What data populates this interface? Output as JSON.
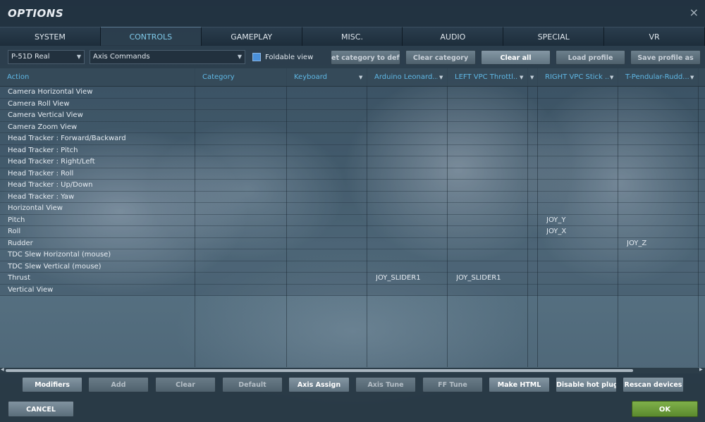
{
  "window": {
    "title": "OPTIONS",
    "close_glyph": "×"
  },
  "tabs": [
    {
      "label": "SYSTEM",
      "active": false
    },
    {
      "label": "CONTROLS",
      "active": true
    },
    {
      "label": "GAMEPLAY",
      "active": false
    },
    {
      "label": "MISC.",
      "active": false
    },
    {
      "label": "AUDIO",
      "active": false
    },
    {
      "label": "SPECIAL",
      "active": false
    },
    {
      "label": "VR",
      "active": false
    }
  ],
  "toolbar": {
    "aircraft_select": "P-51D Real",
    "category_select": "Axis Commands",
    "foldable_view_label": "Foldable view",
    "foldable_view_checked": true,
    "reset_category_label": "et category to defa",
    "clear_category_label": "Clear category",
    "clear_all_label": "Clear all",
    "load_profile_label": "Load profile",
    "save_profile_label": "Save profile as"
  },
  "grid": {
    "headers": {
      "action": "Action",
      "category": "Category",
      "keyboard": "Keyboard",
      "device1": "Arduino Leonard...",
      "device2": "LEFT VPC Throttl...",
      "device3": "RIGHT VPC Stick ...",
      "device4": "T-Pendular-Rudd..."
    },
    "rows": [
      {
        "action": "Camera Horizontal View",
        "d1": "",
        "d2": "",
        "d3": "",
        "d4": ""
      },
      {
        "action": "Camera Roll View",
        "d1": "",
        "d2": "",
        "d3": "",
        "d4": ""
      },
      {
        "action": "Camera Vertical View",
        "d1": "",
        "d2": "",
        "d3": "",
        "d4": ""
      },
      {
        "action": "Camera Zoom View",
        "d1": "",
        "d2": "",
        "d3": "",
        "d4": ""
      },
      {
        "action": "Head Tracker : Forward/Backward",
        "d1": "",
        "d2": "",
        "d3": "",
        "d4": ""
      },
      {
        "action": "Head Tracker : Pitch",
        "d1": "",
        "d2": "",
        "d3": "",
        "d4": ""
      },
      {
        "action": "Head Tracker : Right/Left",
        "d1": "",
        "d2": "",
        "d3": "",
        "d4": ""
      },
      {
        "action": "Head Tracker : Roll",
        "d1": "",
        "d2": "",
        "d3": "",
        "d4": ""
      },
      {
        "action": "Head Tracker : Up/Down",
        "d1": "",
        "d2": "",
        "d3": "",
        "d4": ""
      },
      {
        "action": "Head Tracker : Yaw",
        "d1": "",
        "d2": "",
        "d3": "",
        "d4": ""
      },
      {
        "action": "Horizontal View",
        "d1": "",
        "d2": "",
        "d3": "",
        "d4": ""
      },
      {
        "action": "Pitch",
        "d1": "",
        "d2": "",
        "d3": "JOY_Y",
        "d4": ""
      },
      {
        "action": "Roll",
        "d1": "",
        "d2": "",
        "d3": "JOY_X",
        "d4": ""
      },
      {
        "action": "Rudder",
        "d1": "",
        "d2": "",
        "d3": "",
        "d4": "JOY_Z"
      },
      {
        "action": "TDC Slew Horizontal (mouse)",
        "d1": "",
        "d2": "",
        "d3": "",
        "d4": ""
      },
      {
        "action": "TDC Slew Vertical (mouse)",
        "d1": "",
        "d2": "",
        "d3": "",
        "d4": ""
      },
      {
        "action": "Thrust",
        "d1": "JOY_SLIDER1",
        "d2": "JOY_SLIDER1",
        "d3": "",
        "d4": ""
      },
      {
        "action": "Vertical View",
        "d1": "",
        "d2": "",
        "d3": "",
        "d4": ""
      }
    ]
  },
  "bottom_buttons": {
    "modifiers": "Modifiers",
    "add": "Add",
    "clear": "Clear",
    "default": "Default",
    "axis_assign": "Axis Assign",
    "axis_tune": "Axis Tune",
    "ff_tune": "FF Tune",
    "make_html": "Make HTML",
    "disable_hot_plug": "Disable hot plug",
    "rescan_devices": "Rescan devices"
  },
  "footer": {
    "cancel_label": "CANCEL",
    "ok_label": "OK"
  },
  "colors": {
    "accent": "#5fb7e4",
    "ok_green": "#6e9f3c",
    "checkbox_blue": "#4a90d9"
  },
  "icons": {
    "close": "close-icon",
    "dropdown": "chevron-down-icon",
    "scroll_left": "arrow-left-icon",
    "scroll_right": "arrow-right-icon"
  }
}
